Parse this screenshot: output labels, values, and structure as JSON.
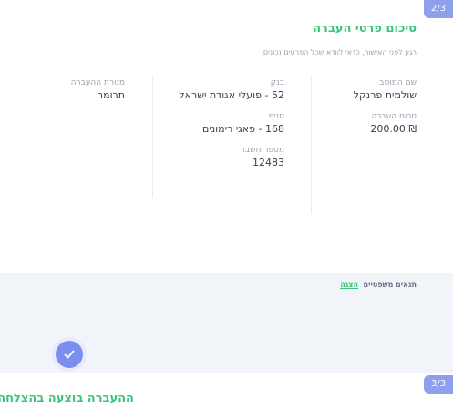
{
  "summary": {
    "step_badge": "2/3",
    "title": "סיכום פרטי העברה",
    "subtitle": "רגע לפני האישור, כדאי לוודא שכל הפרטים נכונים",
    "beneficiary_label": "שם המוטב",
    "beneficiary_value": "שולמית פרנקל",
    "amount_label": "סכום העברה",
    "amount_value": "₪ 200.00",
    "bank_label": "בנק",
    "bank_value": "52 - פועלי אגודת ישראל",
    "branch_label": "סניף",
    "branch_value": "168 - פאגי רימונים",
    "account_label": "מספר חשבון",
    "account_value": "12483",
    "purpose_label": "מטרת ההעברה",
    "purpose_value": "תרומה"
  },
  "terms": {
    "label": "תנאים משפטיים",
    "link": "הצגה"
  },
  "success": {
    "step_badge": "3/3",
    "title": "ההעברה בוצעה בהצלחה"
  }
}
